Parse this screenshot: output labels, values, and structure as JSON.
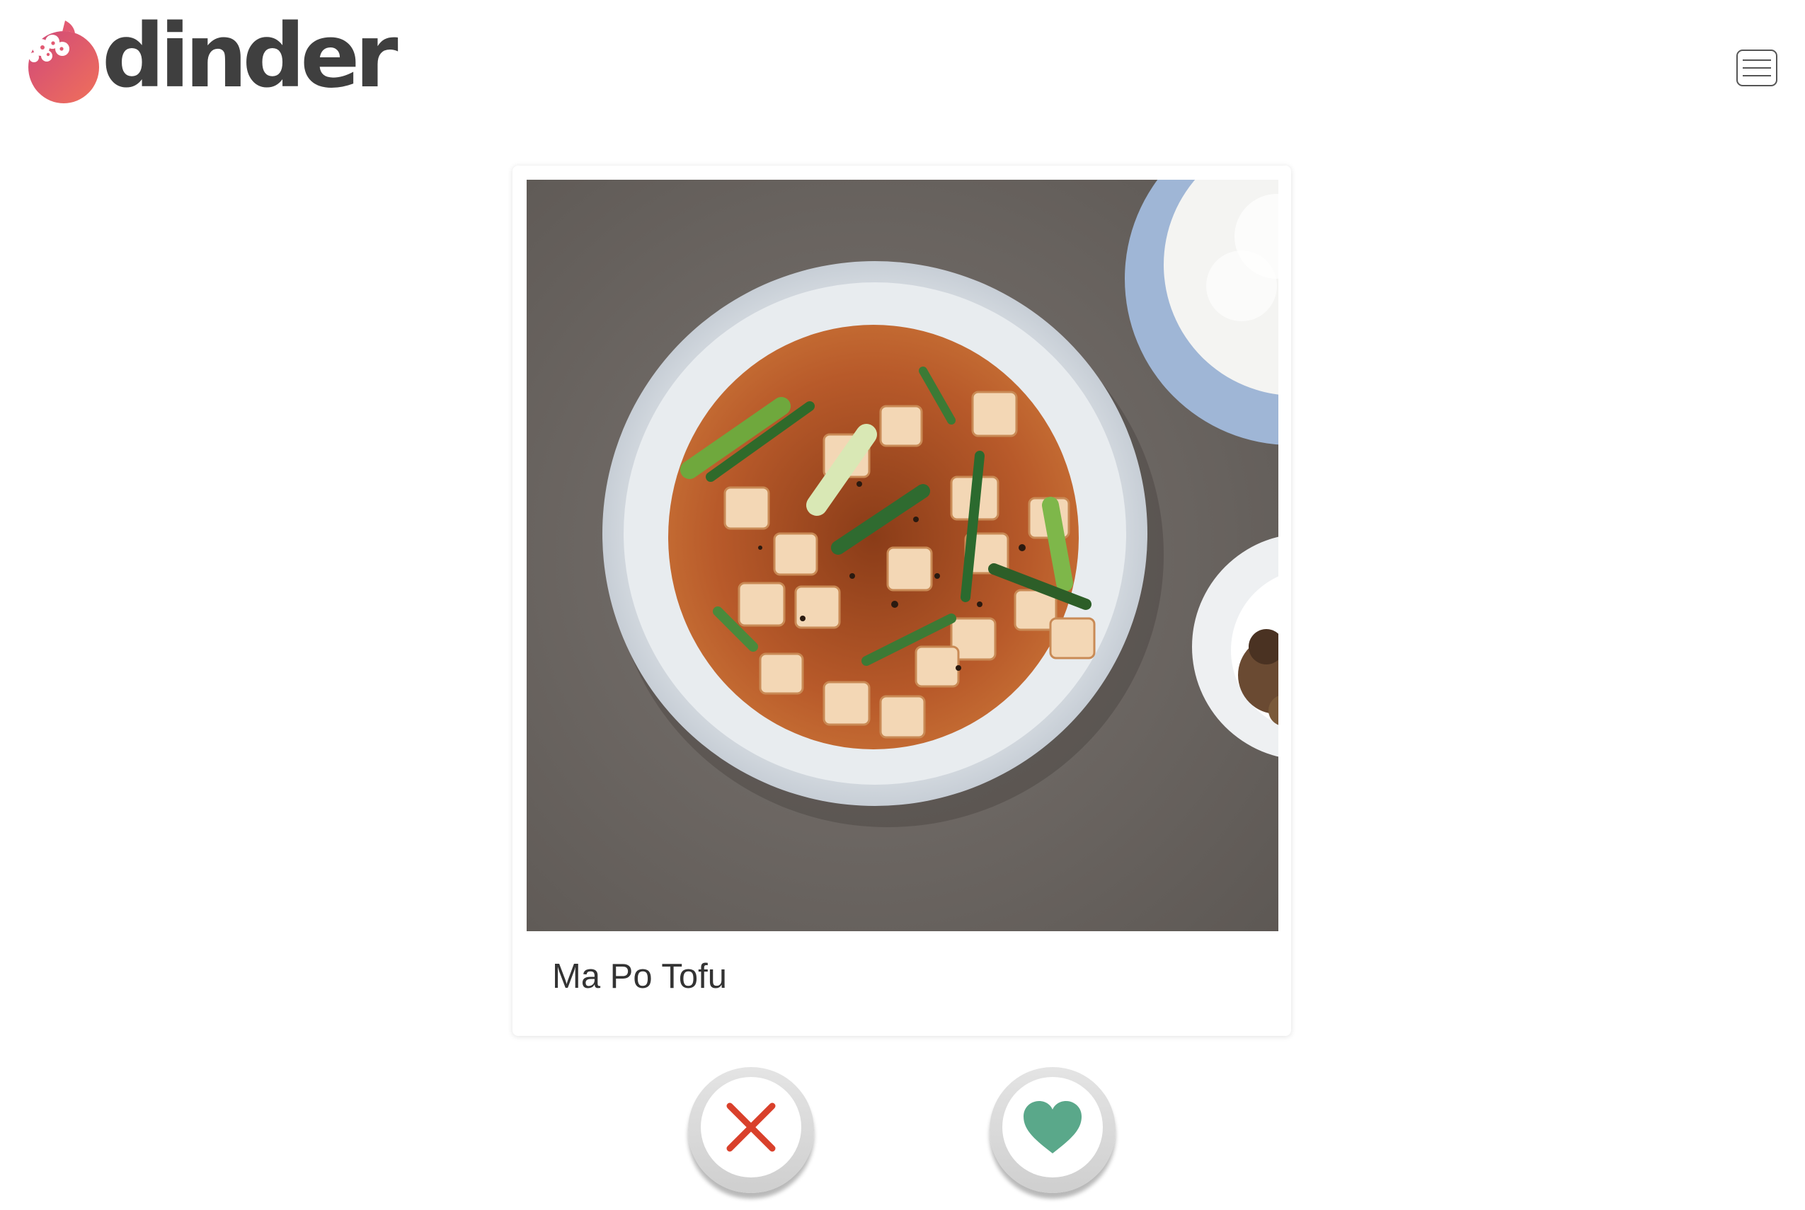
{
  "app": {
    "brand_name": "dinder",
    "brand_color": "#e25a72",
    "text_color": "#3f3f3f"
  },
  "header": {
    "menu_icon": "hamburger-icon"
  },
  "card": {
    "title": "Ma Po Tofu",
    "photo_subject": "ma-po-tofu-photo"
  },
  "actions": {
    "reject_icon": "close-icon",
    "reject_color": "#d9402b",
    "like_icon": "heart-icon",
    "like_color": "#5aa88a"
  }
}
